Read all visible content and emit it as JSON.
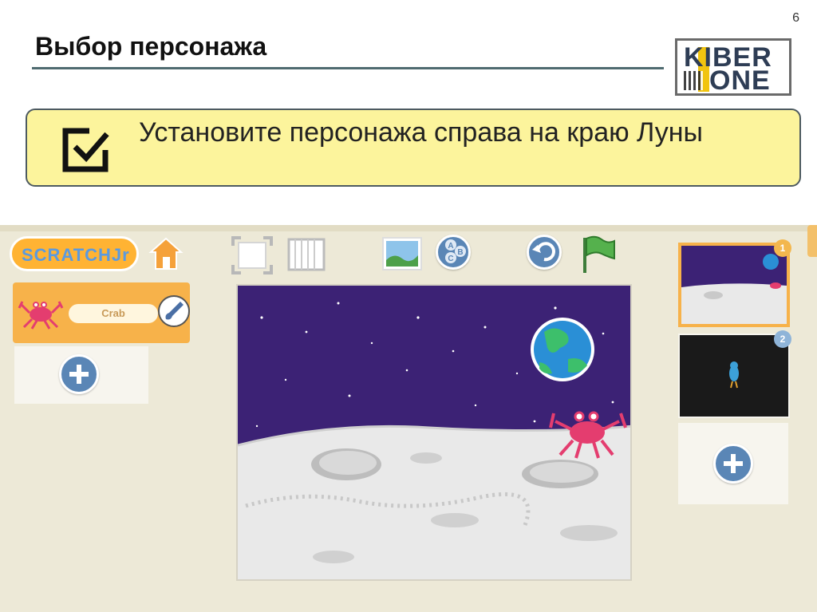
{
  "slide": {
    "page_number": "6",
    "title": "Выбор персонажа",
    "task_text": "Установите персонажа справа на краю Луны",
    "logo": {
      "line1": "KIBER",
      "line2": "ONE",
      "icon": "kiber-one-logo"
    }
  },
  "app": {
    "name": "ScratchJr",
    "logo_text": "SCRATCHJr",
    "toolbar": {
      "home_icon": "home-icon",
      "fullscreen_icon": "fullscreen-icon",
      "grid_icon": "grid-icon",
      "background_icon": "background-picture-icon",
      "text_icon": "abc-text-icon",
      "reset_icon": "reset-icon",
      "green_flag_icon": "green-flag-icon"
    },
    "sprites": [
      {
        "name": "Crab",
        "icon": "crab-icon",
        "edit_icon": "paintbrush-icon"
      }
    ],
    "add_sprite_icon": "plus-icon",
    "pages": [
      {
        "number": "1",
        "selected": true,
        "scene": "moon"
      },
      {
        "number": "2",
        "selected": false,
        "scene": "dark"
      }
    ],
    "add_page_icon": "plus-icon"
  },
  "colors": {
    "task_box": "#fcf49c",
    "stage_sky": "#3c2275",
    "sprite_card": "#f7b24a",
    "app_background": "#ede9d7",
    "button_blue": "#5a86b6"
  }
}
